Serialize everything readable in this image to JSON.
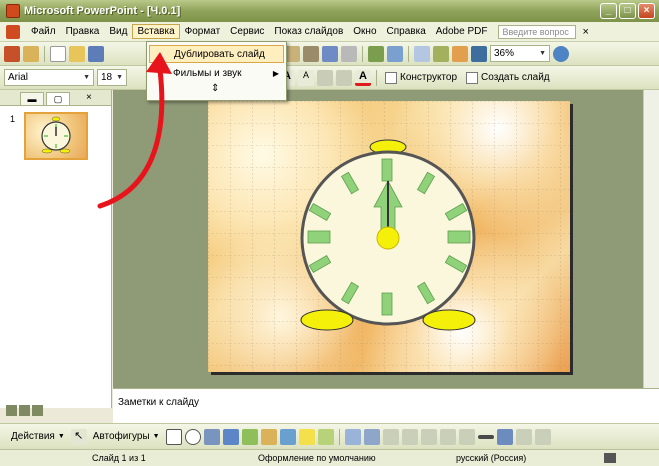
{
  "window": {
    "title": "Microsoft PowerPoint - [Ч.0.1]"
  },
  "menubar": {
    "items": [
      "Файл",
      "Правка",
      "Вид",
      "Вставка",
      "Формат",
      "Сервис",
      "Показ слайдов",
      "Окно",
      "Справка",
      "Adobe PDF"
    ],
    "active_index": 3,
    "help_placeholder": "Введите вопрос"
  },
  "toolbar1": {
    "zoom": "36%"
  },
  "toolbar2": {
    "font_name": "Arial",
    "font_size": "18",
    "designer_label": "Конструктор",
    "new_slide_label": "Создать слайд"
  },
  "insert_menu": {
    "items": [
      {
        "label": "Дублировать слайд",
        "highlighted": true
      },
      {
        "label": "Фильмы и звук",
        "submenu": true
      }
    ],
    "expand_glyph": "⇕"
  },
  "left_panel": {
    "slide_number": "1"
  },
  "notes": {
    "placeholder": "Заметки к слайду"
  },
  "drawing_toolbar": {
    "actions_label": "Действия",
    "autoshapes_label": "Автофигуры"
  },
  "statusbar": {
    "slide_info": "Слайд 1 из 1",
    "design": "Оформление по умолчанию",
    "language": "русский (Россия)"
  },
  "colors": {
    "title_bar": "#8FA35A",
    "menu_highlight": "#FFEFBF",
    "clock_face": "#FAF7DC",
    "clock_marks": "#8FD27A",
    "clock_feet": "#F5F00A",
    "annotation_arrow": "#E8141C"
  }
}
